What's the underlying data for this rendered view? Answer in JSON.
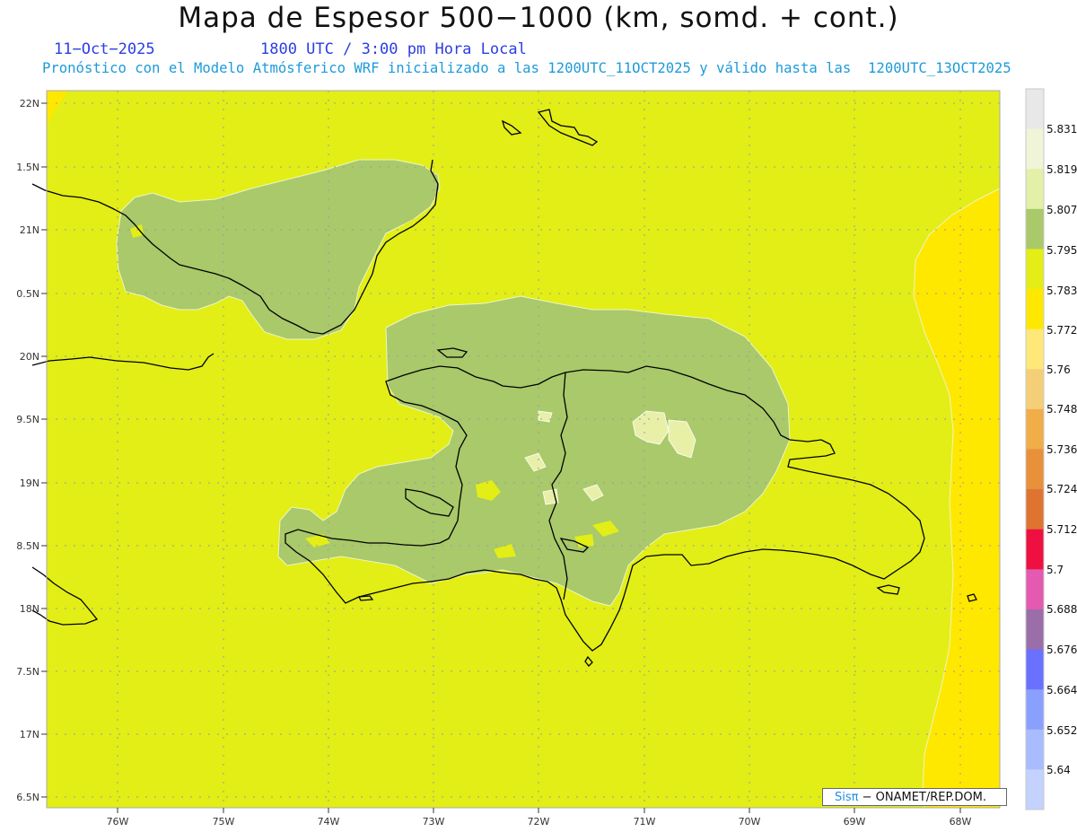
{
  "header": {
    "title": "Mapa de Espesor 500−1000 (km, somd. + cont.)",
    "date": "11−Oct−2025",
    "time": "1800 UTC / 3:00 pm Hora Local",
    "description": "Pronóstico con el Modelo Atmósferico WRF inicializado a las 1200UTC_11OCT2025 y válido hasta las  1200UTC_13OCT2025"
  },
  "axes": {
    "lat_labels": [
      "22N",
      "1.5N",
      "21N",
      "0.5N",
      "20N",
      "9.5N",
      "19N",
      "8.5N",
      "18N",
      "7.5N",
      "17N",
      "6.5N"
    ],
    "lon_labels": [
      "76W",
      "75W",
      "74W",
      "73W",
      "72W",
      "71W",
      "70W",
      "69W",
      "68W"
    ]
  },
  "colorbar": {
    "labels": [
      "5.831",
      "5.819",
      "5.807",
      "5.795",
      "5.783",
      "5.772",
      "5.76",
      "5.748",
      "5.736",
      "5.724",
      "5.712",
      "5.7",
      "5.688",
      "5.676",
      "5.664",
      "5.652",
      "5.64"
    ],
    "colors": [
      "#e8e8e8",
      "#f0f5d8",
      "#e2f0a8",
      "#a9c96a",
      "#e2ee16",
      "#ffe800",
      "#ffe878",
      "#f5cf78",
      "#f0ad48",
      "#e8903a",
      "#de7430",
      "#ee1040",
      "#e45ab0",
      "#9a6ea8",
      "#6a70ff",
      "#8aa0ff",
      "#a8bcff",
      "#c4d2ff"
    ]
  },
  "colors": {
    "field_background": "#e2ee16",
    "field_high": "#a9c96a",
    "field_highest": "#e8f0a8",
    "field_low": "#ffe800",
    "coastline": "#000000",
    "grid": "#999999"
  },
  "credit": {
    "brand": "Sisπ",
    "text": " − ONAMET/REP.DOM."
  }
}
